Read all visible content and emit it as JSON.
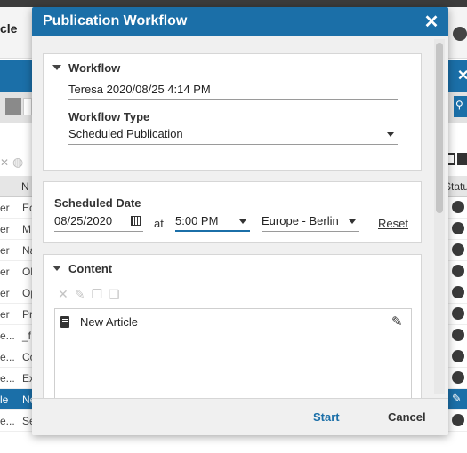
{
  "background": {
    "header_title": "cle",
    "rows": [
      {
        "c1": "er",
        "c2": "Ec"
      },
      {
        "c1": "er",
        "c2": "M"
      },
      {
        "c1": "er",
        "c2": "Na"
      },
      {
        "c1": "er",
        "c2": "Ol"
      },
      {
        "c1": "er",
        "c2": "Op"
      },
      {
        "c1": "er",
        "c2": "Pr"
      },
      {
        "c1": "e...",
        "c2": "_f"
      },
      {
        "c1": "e...",
        "c2": "Co"
      },
      {
        "c1": "e...",
        "c2": "Ex"
      },
      {
        "c1": "le",
        "c2": "Ne"
      },
      {
        "c1": "e...",
        "c2": "Se"
      }
    ],
    "column_n": "N",
    "column_status": "Statu",
    "search_placeholder": "S"
  },
  "dialog": {
    "title": "Publication Workflow",
    "close_glyph": "✕",
    "workflow": {
      "section_label": "Workflow",
      "name_value": "Teresa 2020/08/25 4:14 PM",
      "type_label": "Workflow Type",
      "type_value": "Scheduled Publication"
    },
    "schedule": {
      "section_label": "Scheduled Date",
      "date_value": "08/25/2020",
      "at_label": "at",
      "time_value": "5:00 PM",
      "timezone_value": "Europe - Berlin",
      "reset_label": "Reset"
    },
    "content": {
      "section_label": "Content",
      "items": [
        {
          "label": "New Article"
        }
      ]
    },
    "footer": {
      "start_label": "Start",
      "cancel_label": "Cancel"
    }
  },
  "colors": {
    "accent": "#1b6fa8",
    "panel_bg": "#f0f0f0"
  }
}
